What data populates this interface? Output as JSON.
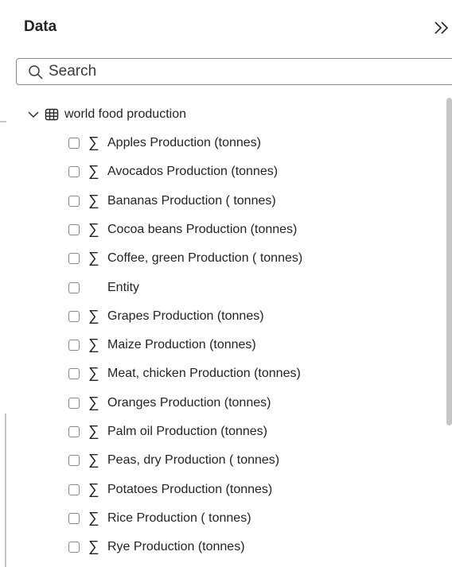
{
  "pane": {
    "title": "Data",
    "collapse_icon": "double-chevron-right-icon"
  },
  "search": {
    "placeholder": "Search",
    "value": ""
  },
  "table": {
    "name": "world food production",
    "expanded": true,
    "fields": [
      {
        "label": "Apples Production (tonnes)",
        "type": "sum",
        "checked": false
      },
      {
        "label": "Avocados Production (tonnes)",
        "type": "sum",
        "checked": false
      },
      {
        "label": "Bananas Production ( tonnes)",
        "type": "sum",
        "checked": false
      },
      {
        "label": "Cocoa beans Production (tonnes)",
        "type": "sum",
        "checked": false
      },
      {
        "label": "Coffee, green Production ( tonnes)",
        "type": "sum",
        "checked": false
      },
      {
        "label": "Entity",
        "type": "text",
        "checked": false
      },
      {
        "label": "Grapes Production (tonnes)",
        "type": "sum",
        "checked": false
      },
      {
        "label": "Maize Production (tonnes)",
        "type": "sum",
        "checked": false
      },
      {
        "label": "Meat, chicken Production (tonnes)",
        "type": "sum",
        "checked": false
      },
      {
        "label": "Oranges Production (tonnes)",
        "type": "sum",
        "checked": false
      },
      {
        "label": "Palm oil Production (tonnes)",
        "type": "sum",
        "checked": false
      },
      {
        "label": "Peas, dry Production ( tonnes)",
        "type": "sum",
        "checked": false
      },
      {
        "label": "Potatoes Production (tonnes)",
        "type": "sum",
        "checked": false
      },
      {
        "label": "Rice Production ( tonnes)",
        "type": "sum",
        "checked": false
      },
      {
        "label": "Rye Production (tonnes)",
        "type": "sum",
        "checked": false
      }
    ]
  },
  "sigma_glyph": "∑"
}
